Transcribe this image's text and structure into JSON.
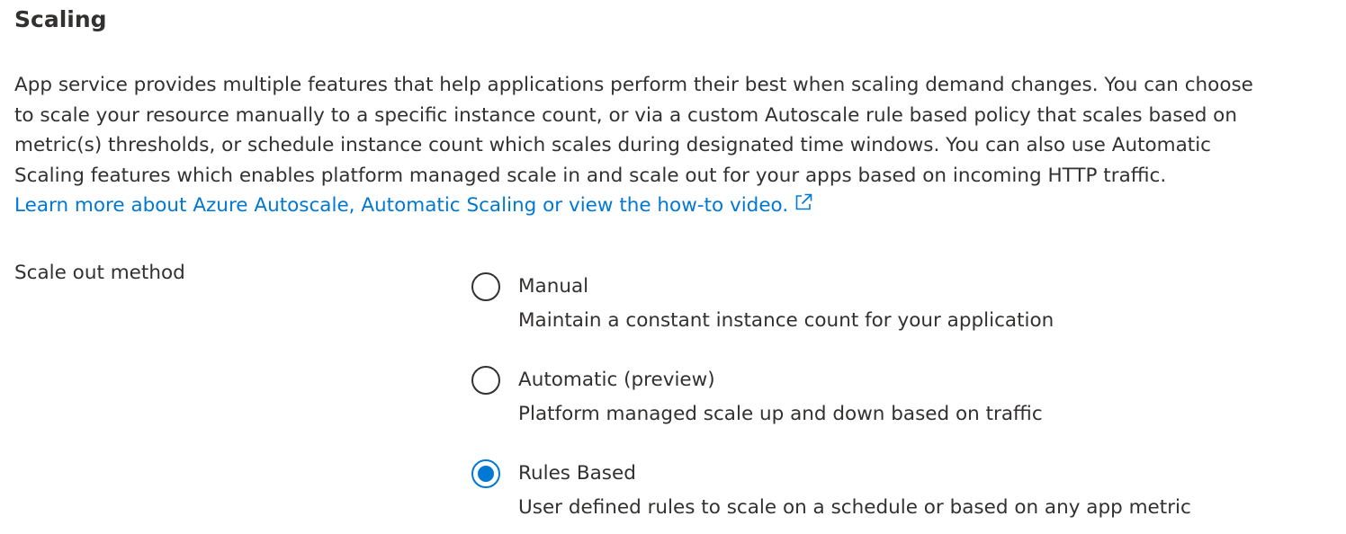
{
  "section": {
    "title": "Scaling"
  },
  "description": {
    "lines": [
      "App service provides multiple features that help applications perform their best when scaling demand changes. You can choose",
      "to scale your resource manually to a specific instance count, or via a custom Autoscale rule based policy that scales based on",
      "metric(s) thresholds, or schedule instance count which scales during designated time windows. You can also use Automatic",
      "Scaling features which enables platform managed scale in and scale out for your apps based on incoming HTTP traffic."
    ],
    "link_text": "Learn more about Azure Autoscale, Automatic Scaling or view the how-to video.",
    "link_icon": "external-link-icon"
  },
  "scale_out_method": {
    "label": "Scale out method",
    "selected": "Rules Based",
    "options": [
      {
        "title": "Manual",
        "description": "Maintain a constant instance count for your application",
        "checked": false
      },
      {
        "title": "Automatic (preview)",
        "description": "Platform managed scale up and down based on traffic",
        "checked": false
      },
      {
        "title": "Rules Based",
        "description": "User defined rules to scale on a schedule or based on any app metric",
        "checked": true
      }
    ]
  },
  "colors": {
    "text": "#323130",
    "link": "#0078d4",
    "radio_selected": "#0078d4",
    "background": "#ffffff"
  }
}
